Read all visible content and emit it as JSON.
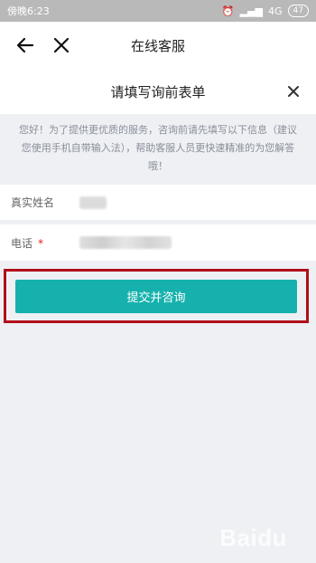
{
  "status": {
    "time": "傍晚6:23",
    "network": "4G",
    "battery": "47"
  },
  "nav": {
    "title": "在线客服"
  },
  "form": {
    "title": "请填写询前表单",
    "notice": "您好！为了提供更优质的服务，咨询前请先填写以下信息（建议您使用手机自带输入法），帮助客服人员更快速精准的为您解答哦！",
    "fields": [
      {
        "label": "真实姓名",
        "required": false
      },
      {
        "label": "电话",
        "required": true,
        "required_mark": "*"
      }
    ],
    "submit_label": "提交并咨询"
  },
  "watermark": "Baidu"
}
